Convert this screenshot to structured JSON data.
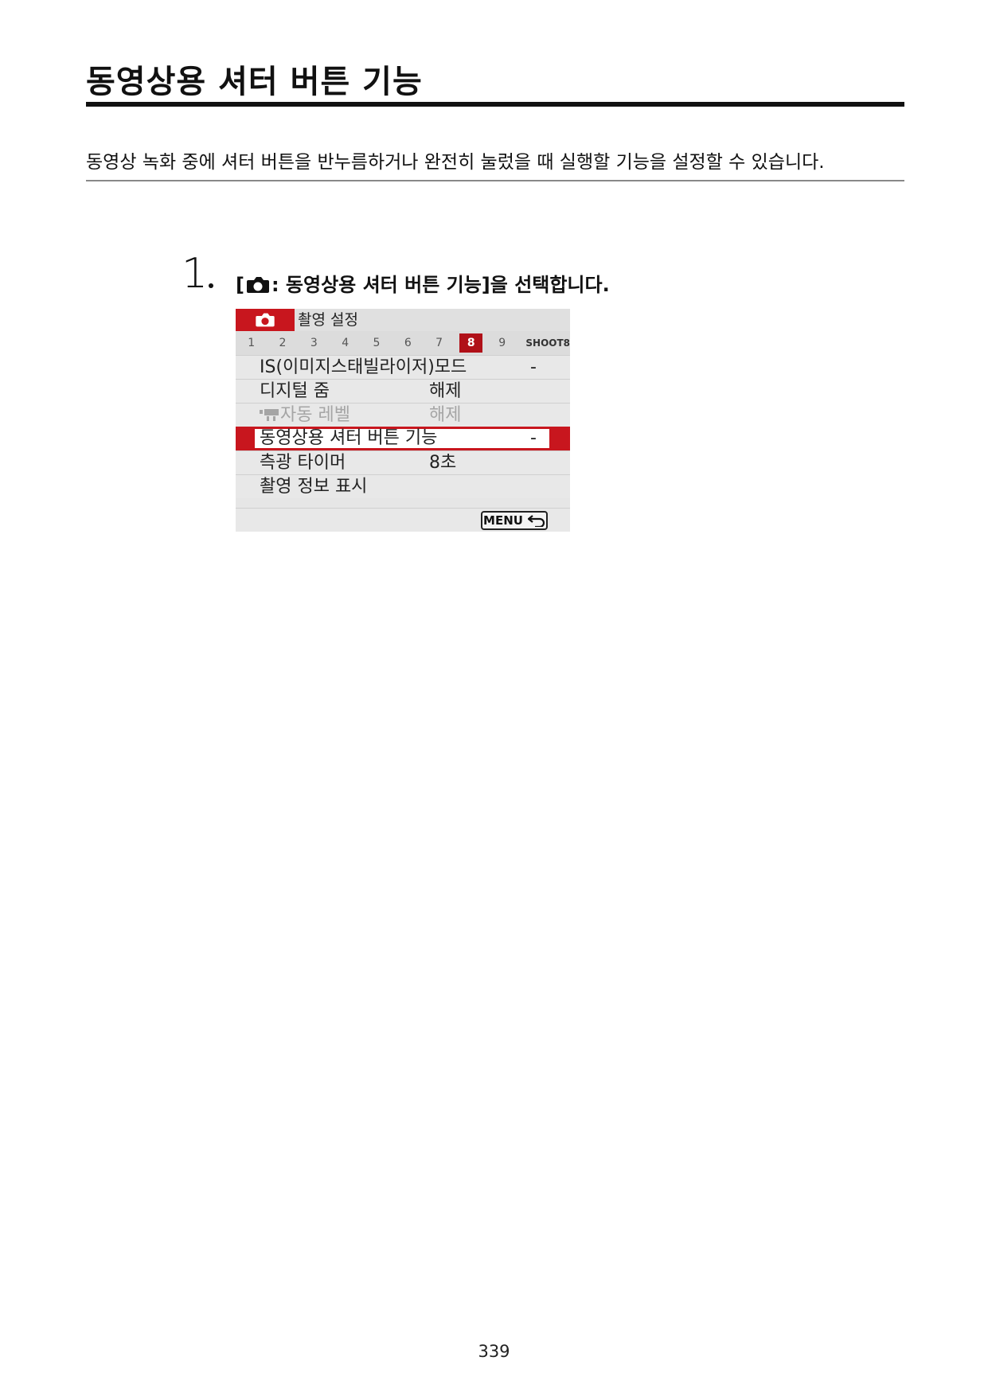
{
  "page": {
    "title": "동영상용 셔터 버튼 기능",
    "intro": "동영상 녹화 중에 셔터 버튼을 반누름하거나 완전히 눌렀을 때 실행할 기능을 설정할 수 있습니다.",
    "page_number": "339"
  },
  "step": {
    "number": "1",
    "open_bracket": "[",
    "icon": "camera-icon",
    "text": ": 동영상용 셔터 버튼 기능]을 선택합니다."
  },
  "menu": {
    "tab_icon": "camera-icon",
    "tab_title": "촬영 설정",
    "pages": [
      "1",
      "2",
      "3",
      "4",
      "5",
      "6",
      "7",
      "8",
      "9"
    ],
    "active_page": "8",
    "page_tag": "SHOOT8",
    "accent_color": "#c8161e",
    "items": [
      {
        "label": "IS(이미지스태빌라이저)모드",
        "value": "-"
      },
      {
        "label": "디지털 줌",
        "value": "해제"
      },
      {
        "label": "자동 레벨",
        "value": "해제",
        "icon": "movie-camera-icon",
        "disabled": true
      },
      {
        "label": "동영상용 셔터 버튼 기능",
        "value": "-",
        "selected": true
      },
      {
        "label": "측광 타이머",
        "value": "8초"
      },
      {
        "label": "촬영 정보 표시",
        "value": ""
      }
    ],
    "menu_button": "MENU",
    "back_icon": "return-arrow-icon"
  }
}
